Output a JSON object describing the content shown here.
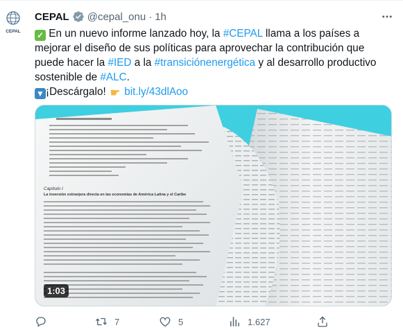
{
  "author": {
    "display_name": "CEPAL",
    "handle": "@cepal_onu",
    "separator": "·",
    "time": "1h",
    "verified_color": "#829aab",
    "avatar_text": "CEPAL"
  },
  "tweet": {
    "line1_text": " En un nuevo informe lanzado hoy, la ",
    "hashtag_cepal": "#CEPAL",
    "line1_tail": " llama a los países a mejorar el diseño de sus políticas para aprovechar la contribución que puede hacer la ",
    "hashtag_ied": "#IED",
    "mid_text": " a la ",
    "hashtag_transicion": "#transiciónenergética",
    "mid_text2": " y al desarrollo productivo sostenible de ",
    "hashtag_alc": "#ALC",
    "period": ".",
    "cta_text": "¡Descárgalo! ",
    "link": "bit.ly/43dlAoo",
    "emoji_check": "check-mark-emoji",
    "emoji_down": "down-arrow-emoji",
    "emoji_hand": "pointing-hand-emoji"
  },
  "media": {
    "duration": "1:03",
    "background_color": "#3ecfe0",
    "heading": "Capítulo I",
    "subheading": "La inversión extranjera directa en las economías de América Latina y el Caribe"
  },
  "actions": {
    "reply_count": "",
    "retweet_count": "7",
    "like_count": "5",
    "views_count": "1.627",
    "share_count": ""
  },
  "colors": {
    "link": "#1d9bf0",
    "muted": "#536471",
    "text": "#0f1419"
  }
}
